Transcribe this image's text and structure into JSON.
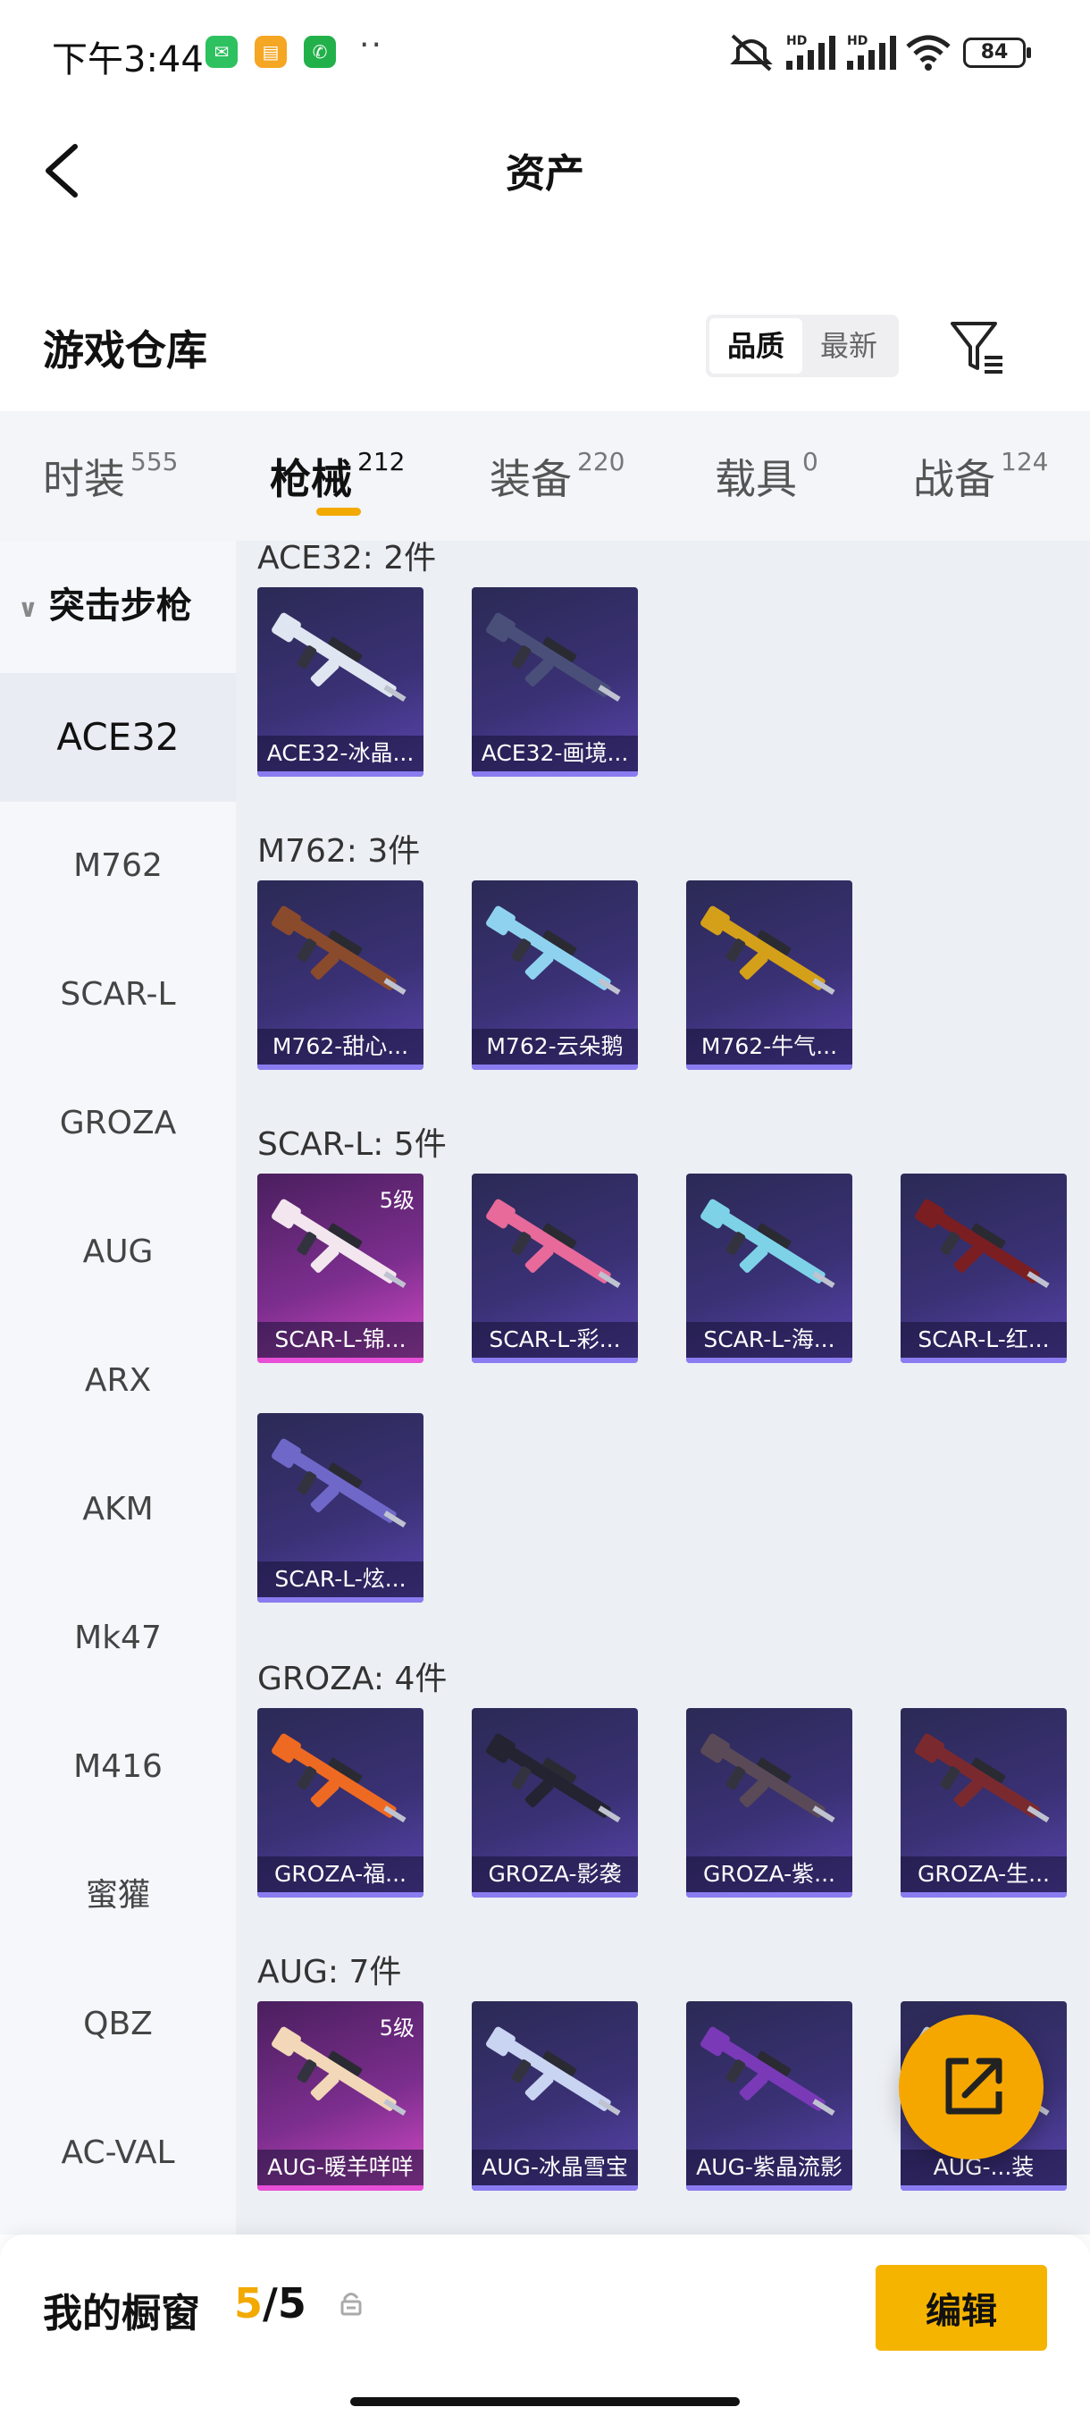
{
  "status_bar": {
    "time": "下午3:44",
    "battery": "84",
    "signal_labels": [
      "HD",
      "HD"
    ]
  },
  "header": {
    "title": "资产"
  },
  "warehouse": {
    "title": "游戏仓库",
    "sort_options": [
      "品质",
      "最新"
    ],
    "sort_active": "品质"
  },
  "tabs": [
    {
      "label": "时装",
      "count": "555"
    },
    {
      "label": "枪械",
      "count": "212"
    },
    {
      "label": "装备",
      "count": "220"
    },
    {
      "label": "载具",
      "count": "0"
    },
    {
      "label": "战备",
      "count": "124"
    }
  ],
  "sidebar": {
    "category": "突击步枪",
    "items": [
      "ACE32",
      "M762",
      "SCAR-L",
      "GROZA",
      "AUG",
      "ARX",
      "AKM",
      "Mk47",
      "M416",
      "蜜獾",
      "QBZ",
      "AC-VAL"
    ]
  },
  "sections": [
    {
      "title": "ACE32: 2件",
      "items": [
        {
          "label": "ACE32-冰晶...",
          "level": "",
          "tier": "purple",
          "color": "#dfe6f2"
        },
        {
          "label": "ACE32-画境...",
          "level": "",
          "tier": "purple",
          "color": "#4a4f7a"
        }
      ]
    },
    {
      "title": "M762: 3件",
      "items": [
        {
          "label": "M762-甜心...",
          "level": "",
          "tier": "purple",
          "color": "#8a4a2c"
        },
        {
          "label": "M762-云朵鹅",
          "level": "",
          "tier": "purple",
          "color": "#8fd2f0"
        },
        {
          "label": "M762-牛气...",
          "level": "",
          "tier": "purple",
          "color": "#d4a019"
        }
      ]
    },
    {
      "title": "SCAR-L: 5件",
      "items": [
        {
          "label": "SCAR-L-锦...",
          "level": "5级",
          "tier": "gold",
          "color": "#f3e6ef"
        },
        {
          "label": "SCAR-L-彩...",
          "level": "",
          "tier": "purple",
          "color": "#e86a9a"
        },
        {
          "label": "SCAR-L-海...",
          "level": "",
          "tier": "purple",
          "color": "#7ed2e8"
        },
        {
          "label": "SCAR-L-红...",
          "level": "",
          "tier": "purple",
          "color": "#7a1e22"
        },
        {
          "label": "SCAR-L-炫...",
          "level": "",
          "tier": "purple",
          "color": "#6f68c9"
        }
      ]
    },
    {
      "title": "GROZA: 4件",
      "items": [
        {
          "label": "GROZA-福...",
          "level": "",
          "tier": "purple",
          "color": "#ee6a22"
        },
        {
          "label": "GROZA-影袭",
          "level": "",
          "tier": "purple",
          "color": "#232331"
        },
        {
          "label": "GROZA-紫...",
          "level": "",
          "tier": "purple",
          "color": "#5a4a58"
        },
        {
          "label": "GROZA-生...",
          "level": "",
          "tier": "purple",
          "color": "#7a2a2e"
        }
      ]
    },
    {
      "title": "AUG: 7件",
      "items": [
        {
          "label": "AUG-暖羊咩咩",
          "level": "5级",
          "tier": "gold",
          "color": "#f2d8b8"
        },
        {
          "label": "AUG-冰晶雪宝",
          "level": "",
          "tier": "purple",
          "color": "#c9d3f2"
        },
        {
          "label": "AUG-紫晶流影",
          "level": "",
          "tier": "purple",
          "color": "#7a3ab8"
        },
        {
          "label": "AUG-...装",
          "level": "",
          "tier": "purple",
          "color": "#c8d0d8"
        },
        {
          "label": "",
          "level": "",
          "tier": "purple",
          "color": "#9aa0a8"
        },
        {
          "label": "",
          "level": "",
          "tier": "purple",
          "color": "#e0c020"
        },
        {
          "label": "",
          "level": "",
          "tier": "purple",
          "color": "#b07a6a"
        }
      ]
    }
  ],
  "showcase": {
    "label": "我的橱窗",
    "current": "5",
    "total": "/5"
  },
  "edit_label": "编辑",
  "icons": [
    "back-arrow-icon",
    "filter-icon",
    "lock-icon",
    "share-icon",
    "wechat-icon",
    "notes-icon",
    "phone-icon"
  ]
}
